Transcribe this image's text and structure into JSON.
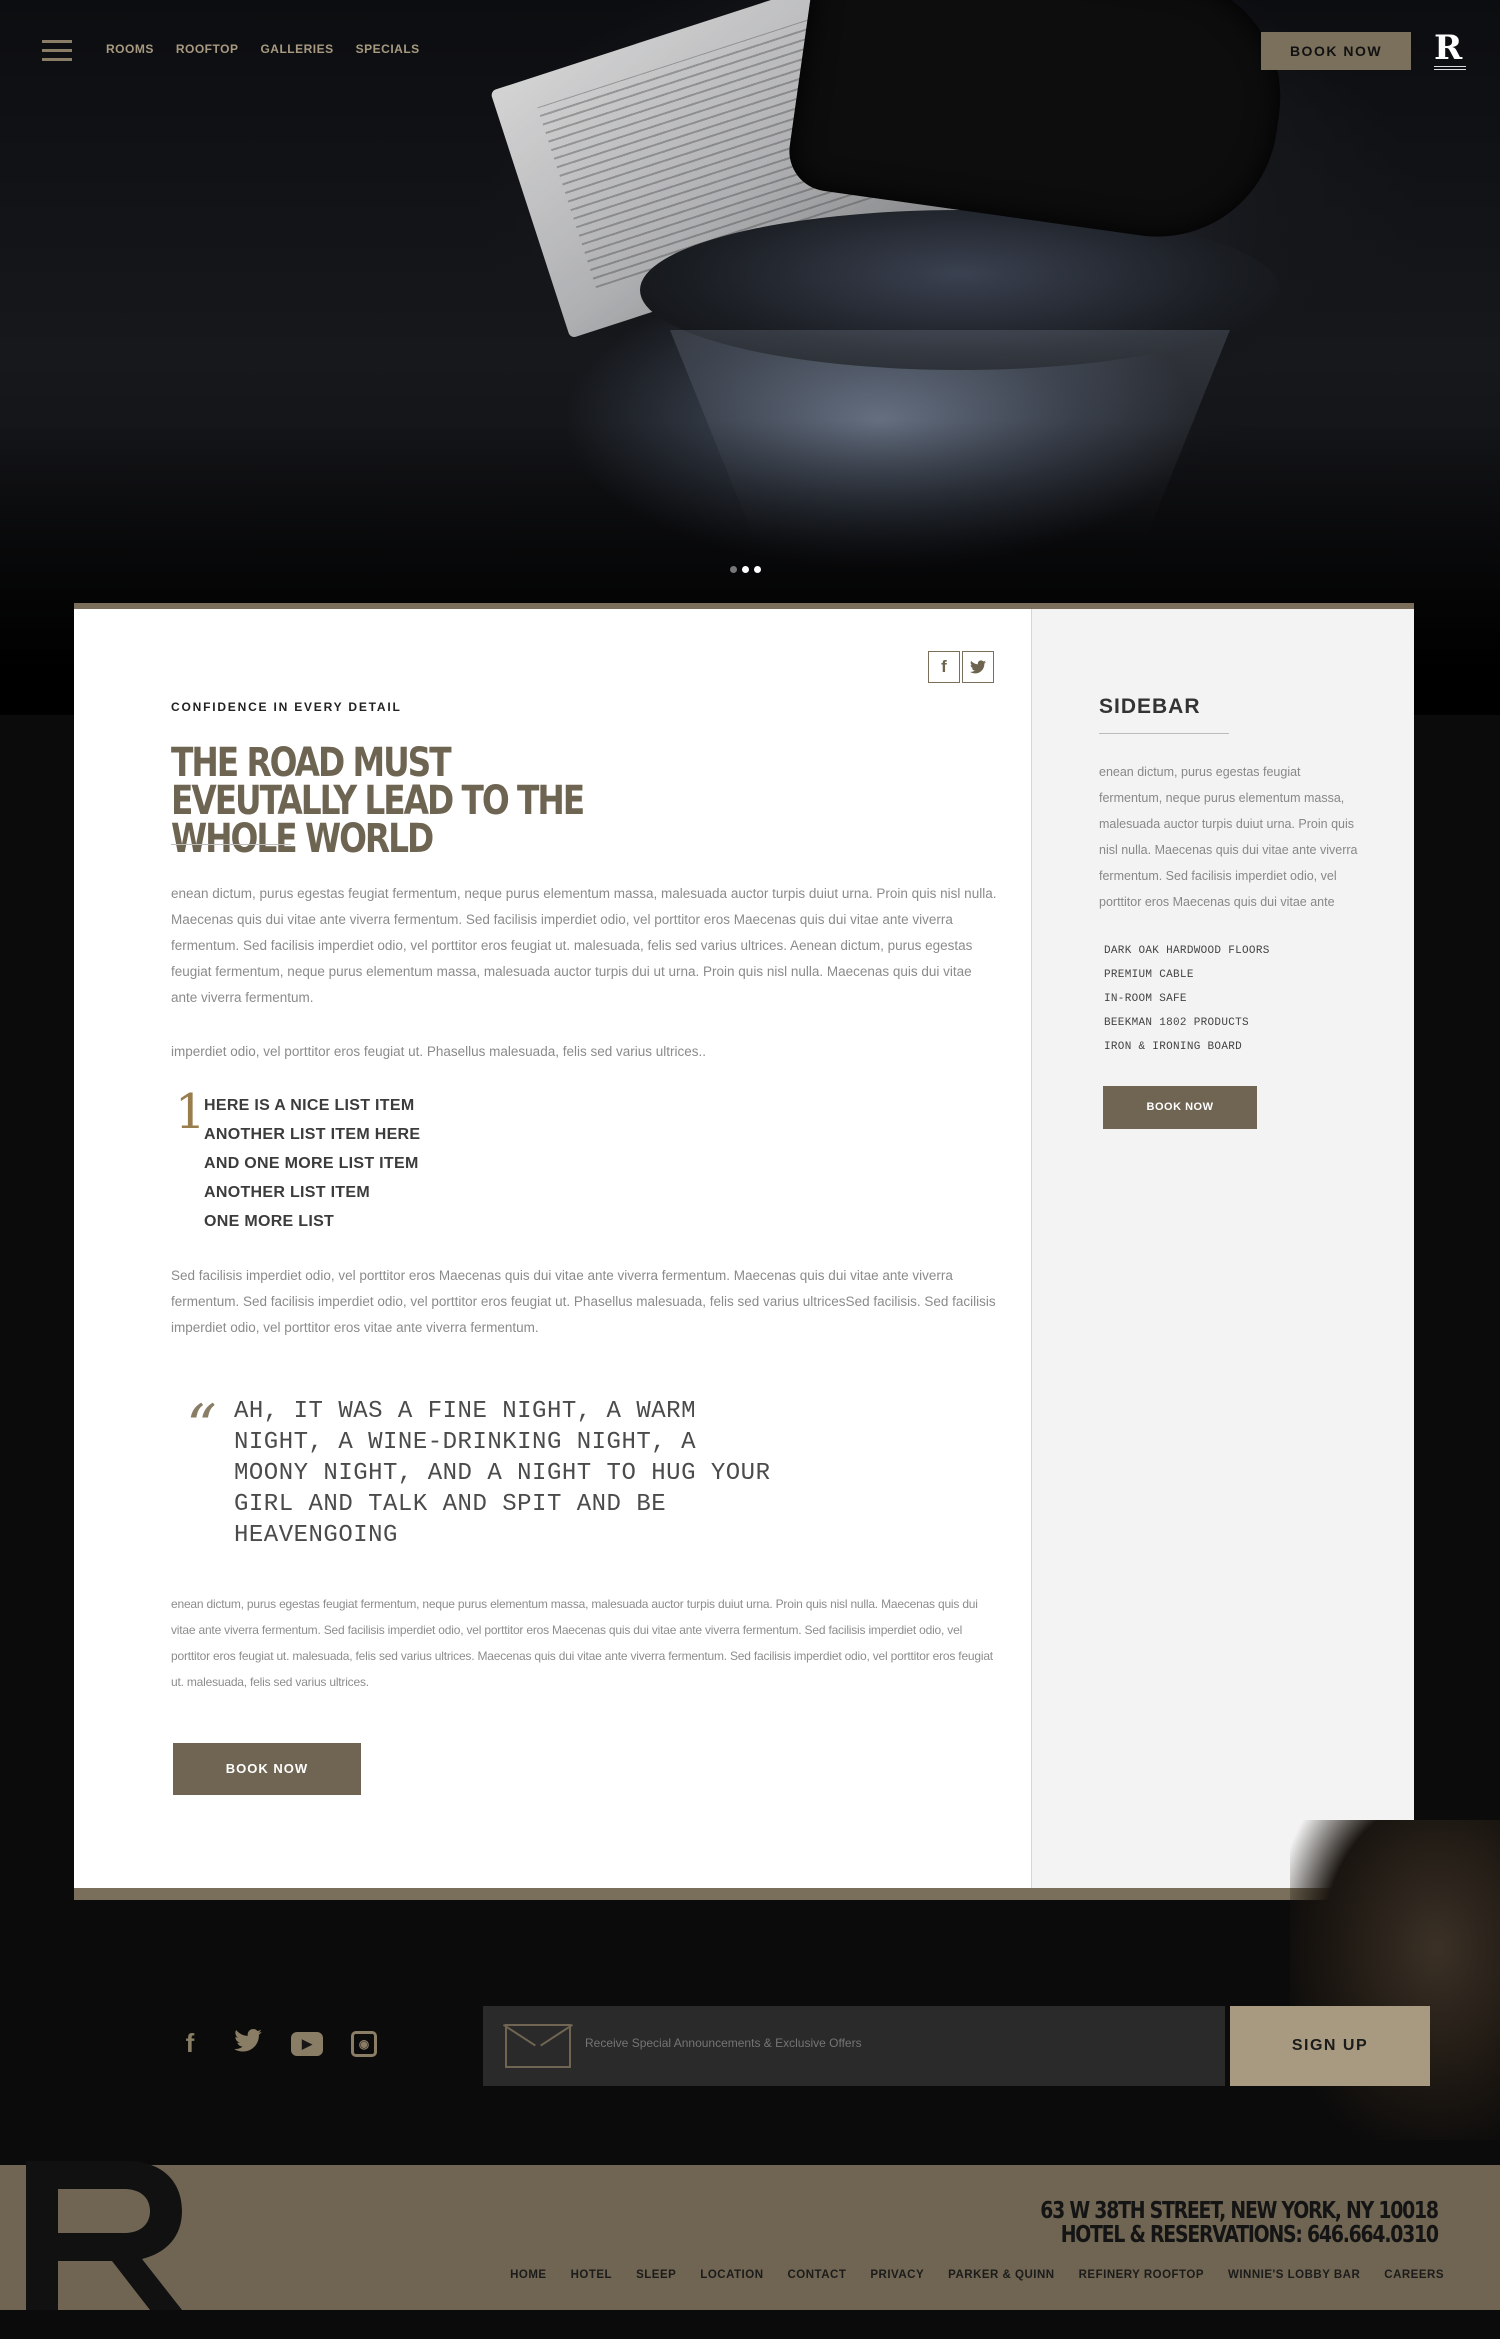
{
  "nav": {
    "links": [
      "ROOMS",
      "ROOFTOP",
      "GALLERIES",
      "SPECIALS"
    ],
    "book_label": "BOOK NOW",
    "logo": "R"
  },
  "slider": {
    "total": 3,
    "active": 1
  },
  "share": {
    "facebook": "f",
    "twitter": "t"
  },
  "article": {
    "kicker": "CONFIDENCE IN EVERY DETAIL",
    "headline": "THE ROAD MUST EVEUTALLY LEAD TO THE WHOLE WORLD",
    "para1": "enean dictum, purus egestas feugiat fermentum, neque purus elementum massa, malesuada auctor turpis duiut urna. Proin quis nisl nulla. Maecenas quis dui vitae ante viverra fermentum. Sed facilisis imperdiet odio, vel porttitor eros  Maecenas quis dui vitae ante viverra fermentum. Sed facilisis imperdiet odio, vel porttitor eros feugiat ut. malesuada, felis sed varius ultrices. Aenean dictum, purus egestas feugiat fermentum, neque purus elementum massa, malesuada auctor turpis dui ut urna. Proin quis nisl nulla. Maecenas quis dui vitae ante viverra fermentum.",
    "para2": "imperdiet odio, vel porttitor eros feugiat ut. Phasellus malesuada, felis sed varius ultrices..",
    "list_number": "1",
    "list": [
      "HERE IS A NICE LIST ITEM",
      "ANOTHER LIST ITEM HERE",
      "AND ONE MORE LIST ITEM",
      "ANOTHER LIST ITEM",
      "ONE MORE LIST"
    ],
    "para3": "Sed facilisis imperdiet odio, vel porttitor eros  Maecenas quis dui vitae ante viverra fermentum. Maecenas quis dui vitae ante viverra fermentum. Sed facilisis imperdiet odio, vel porttitor eros feugiat ut. Phasellus malesuada, felis sed varius ultricesSed facilisis. Sed facilisis imperdiet odio, vel porttitor eros  vitae ante viverra fermentum.",
    "quote": "AH, IT WAS A FINE NIGHT, A WARM NIGHT, A WINE-DRINKING NIGHT, A MOONY NIGHT, AND A NIGHT TO HUG YOUR GIRL AND TALK AND SPIT AND BE HEAVENGOING",
    "para4": "enean dictum, purus egestas feugiat fermentum, neque purus elementum massa, malesuada auctor turpis duiut  urna. Proin quis nisl nulla. Maecenas quis dui vitae ante viverra fermentum. Sed facilisis imperdiet odio, vel porttitor eros  Maecenas quis dui vitae ante viverra fermentum. Sed facilisis imperdiet odio, vel porttitor eros feugiat ut.  malesuada, felis sed varius ultrices.  Maecenas quis dui vitae ante viverra fermentum. Sed facilisis imperdiet odio, vel porttitor eros feugiat ut.  malesuada, felis sed varius ultrices.",
    "book_label": "BOOK NOW"
  },
  "sidebar": {
    "title": "SIDEBAR",
    "text": "enean dictum, purus egestas feugiat fermentum, neque purus elementum massa, malesuada auctor turpis duiut  urna. Proin quis nisl nulla. Maecenas quis dui vitae ante viverra fermentum. Sed facilisis imperdiet odio, vel porttitor eros  Maecenas quis dui vitae ante",
    "features": [
      "DARK OAK HARDWOOD FLOORS",
      "PREMIUM CABLE",
      "IN-ROOM SAFE",
      "BEEKMAN 1802 PRODUCTS",
      "IRON & IRONING BOARD"
    ],
    "book_label": "BOOK NOW"
  },
  "footer": {
    "social_icons": [
      "facebook-icon",
      "twitter-icon",
      "youtube-icon",
      "instagram-icon"
    ],
    "newsletter_placeholder": "Receive Special Announcements & Exclusive Offers",
    "signup_label": "SIGN UP",
    "address_line1": "63 W 38TH STREET, NEW YORK, NY 10018",
    "address_line2": "HOTEL & RESERVATIONS: 646.664.0310",
    "links": [
      "HOME",
      "HOTEL",
      "SLEEP",
      "LOCATION",
      "CONTACT",
      "PRIVACY",
      "PARKER & QUINN",
      "REFINERY ROOFTOP",
      "WINNIE'S LOBBY BAR",
      "CAREERS"
    ]
  },
  "colors": {
    "accent": "#6f6552",
    "accent_light": "#a79a80",
    "gold": "#9a7d4d",
    "dark": "#0b0b0b"
  }
}
